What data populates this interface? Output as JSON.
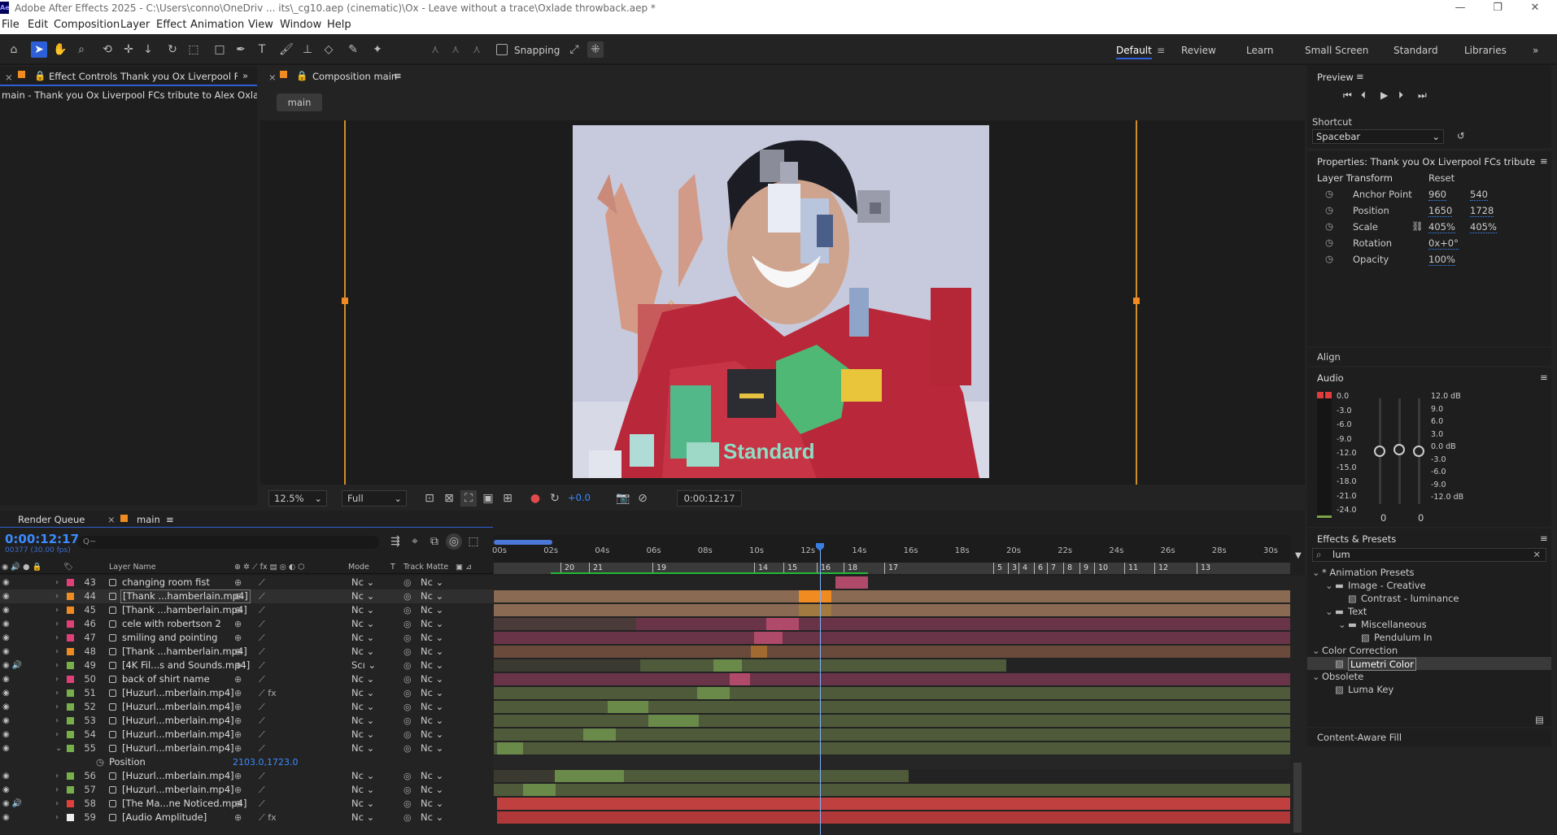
{
  "window": {
    "title": "Adobe After Effects 2025 - C:\\Users\\conno\\OneDriv ... its\\_cg10.aep (cinematic)\\Ox - Leave without a trace\\Oxlade throwback.aep *",
    "min": "—",
    "max": "❐",
    "close": "✕"
  },
  "menu": [
    "File",
    "Edit",
    "Composition",
    "Layer",
    "Effect",
    "Animation",
    "View",
    "Window",
    "Help"
  ],
  "toolbar": {
    "snapping": "Snapping",
    "workspaces": [
      "Default",
      "Review",
      "Learn",
      "Small Screen",
      "Standard",
      "Libraries"
    ],
    "more": "»"
  },
  "effect_controls": {
    "tab": "Effect Controls Thank you Ox Liverpool FCs tribu",
    "subtitle": "main - Thank you Ox Liverpool FCs tribute to Alex Oxlade-Chamb"
  },
  "composition": {
    "tab": "Composition main",
    "crumb": "main",
    "zoom": "12.5%",
    "resolution": "Full",
    "exposure": "+0.0",
    "timecode": "0:00:12:17",
    "frame_text": "Standard"
  },
  "preview": {
    "title": "Preview",
    "shortcut_label": "Shortcut",
    "shortcut": "Spacebar"
  },
  "properties": {
    "title": "Properties: Thank you Ox Liverpool FCs tribute to Alex",
    "section": "Layer Transform",
    "reset": "Reset",
    "rows": [
      {
        "name": "Anchor Point",
        "v1": "960",
        "v2": "540"
      },
      {
        "name": "Position",
        "v1": "1650",
        "v2": "1728"
      },
      {
        "name": "Scale",
        "v1": "405%",
        "v2": "405%"
      },
      {
        "name": "Rotation",
        "v1": "0x+0°",
        "v2": ""
      },
      {
        "name": "Opacity",
        "v1": "100%",
        "v2": ""
      }
    ]
  },
  "align": "Align",
  "audio": {
    "title": "Audio",
    "left_scale": [
      "0.0",
      "-3.0",
      "-6.0",
      "-9.0",
      "-12.0",
      "-15.0",
      "-18.0",
      "-21.0",
      "-24.0"
    ],
    "right_scale": [
      "12.0 dB",
      "9.0",
      "6.0",
      "3.0",
      "0.0 dB",
      "-3.0",
      "-6.0",
      "-9.0",
      "-12.0 dB"
    ],
    "ch_left": "0",
    "ch_right": "0"
  },
  "effects": {
    "title": "Effects & Presets",
    "search": "lum",
    "tree": [
      {
        "t": "* Animation Presets",
        "lvl": 0,
        "type": "cat"
      },
      {
        "t": "Image - Creative",
        "lvl": 1,
        "type": "folder"
      },
      {
        "t": "Contrast - luminance",
        "lvl": 2,
        "type": "item"
      },
      {
        "t": "Text",
        "lvl": 1,
        "type": "folder"
      },
      {
        "t": "Miscellaneous",
        "lvl": 2,
        "type": "folder"
      },
      {
        "t": "Pendulum In",
        "lvl": 3,
        "type": "item"
      },
      {
        "t": "Color Correction",
        "lvl": 0,
        "type": "cat"
      },
      {
        "t": "Lumetri Color",
        "lvl": 1,
        "type": "item",
        "sel": true
      },
      {
        "t": "Obsolete",
        "lvl": 0,
        "type": "cat"
      },
      {
        "t": "Luma Key",
        "lvl": 1,
        "type": "item"
      }
    ]
  },
  "content_aware": "Content-Aware Fill",
  "timeline": {
    "render_queue": "Render Queue",
    "tab": "main",
    "timecode": "0:00:12:17",
    "fps": "00377 (30.00 fps)",
    "search_placeholder": "Q~",
    "col_layer": "Layer Name",
    "col_mode": "Mode",
    "col_t": "T",
    "col_tm": "Track Matte",
    "ruler": [
      "00s",
      "02s",
      "04s",
      "06s",
      "08s",
      "10s",
      "12s",
      "14s",
      "16s",
      "18s",
      "20s",
      "22s",
      "24s",
      "26s",
      "28s",
      "30s"
    ],
    "markers": [
      "20",
      "21",
      "19",
      "14",
      "15",
      "16",
      "18",
      "17",
      "5",
      "3",
      "4",
      "6",
      "7",
      "8",
      "9",
      "10",
      "11",
      "12",
      "13"
    ],
    "position_label": "Position",
    "position_value": "2103.0,1723.0",
    "layers": [
      {
        "n": "43",
        "name": "changing room fist",
        "color": "#e0407a",
        "mode": "Nc",
        "tm": "Nc"
      },
      {
        "n": "44",
        "name": "[Thank ...hamberlain.mp4]",
        "color": "#ef8b20",
        "mode": "Nc",
        "tm": "Nc",
        "boxed": true
      },
      {
        "n": "45",
        "name": "[Thank ...hamberlain.mp4]",
        "color": "#ef8b20",
        "mode": "Nc",
        "tm": "Nc"
      },
      {
        "n": "46",
        "name": "cele with robertson 2",
        "color": "#e0407a",
        "mode": "Nc",
        "tm": "Nc"
      },
      {
        "n": "47",
        "name": "smiling and pointing",
        "color": "#e0407a",
        "mode": "Nc",
        "tm": "Nc"
      },
      {
        "n": "48",
        "name": "[Thank ...hamberlain.mp4]",
        "color": "#ef8b20",
        "mode": "Nc",
        "tm": "Nc"
      },
      {
        "n": "49",
        "name": "[4K Fil...s and Sounds.mp4]",
        "color": "#77b04a",
        "mode": "Scı",
        "tm": "Nc"
      },
      {
        "n": "50",
        "name": "back of shirt name",
        "color": "#e0407a",
        "mode": "Nc",
        "tm": "Nc"
      },
      {
        "n": "51",
        "name": "[Huzurl...mberlain.mp4]",
        "color": "#77b04a",
        "mode": "Nc",
        "tm": "Nc"
      },
      {
        "n": "52",
        "name": "[Huzurl...mberlain.mp4]",
        "color": "#77b04a",
        "mode": "Nc",
        "tm": "Nc"
      },
      {
        "n": "53",
        "name": "[Huzurl...mberlain.mp4]",
        "color": "#77b04a",
        "mode": "Nc",
        "tm": "Nc"
      },
      {
        "n": "54",
        "name": "[Huzurl...mberlain.mp4]",
        "color": "#77b04a",
        "mode": "Nc",
        "tm": "Nc"
      },
      {
        "n": "55",
        "name": "[Huzurl...mberlain.mp4]",
        "color": "#77b04a",
        "mode": "Nc",
        "tm": "Nc"
      },
      {
        "n": "56",
        "name": "[Huzurl...mberlain.mp4]",
        "color": "#77b04a",
        "mode": "Nc",
        "tm": "Nc"
      },
      {
        "n": "57",
        "name": "[Huzurl...mberlain.mp4]",
        "color": "#77b04a",
        "mode": "Nc",
        "tm": "Nc"
      },
      {
        "n": "58",
        "name": "[The Ma...ne Noticed.mp4]",
        "color": "#e0403a",
        "mode": "Nc",
        "tm": "Nc"
      },
      {
        "n": "59",
        "name": "[Audio Amplitude]",
        "color": "#eeeeee",
        "mode": "Nc",
        "tm": "Nc"
      }
    ]
  },
  "colors": {
    "accent": "#2d5fd8",
    "orange": "#ef8b20",
    "timecode": "#3b8bff"
  }
}
